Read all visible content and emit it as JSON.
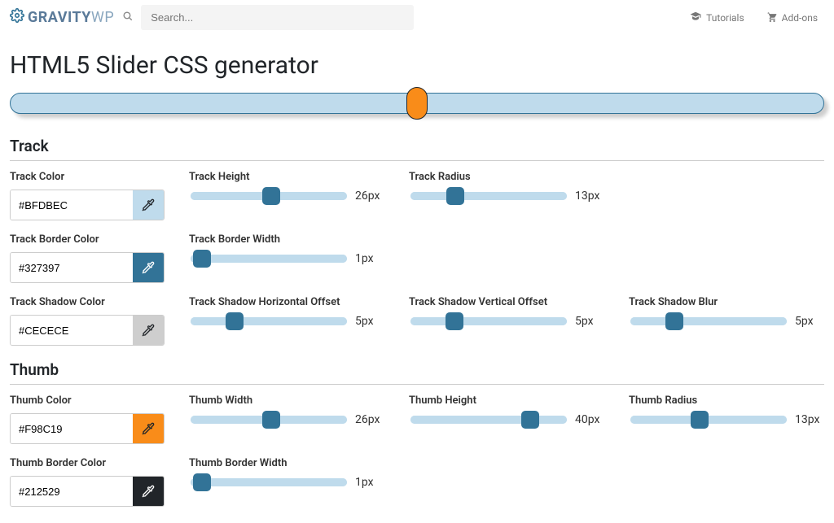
{
  "brand": {
    "strong": "GRAVITY",
    "light": "WP"
  },
  "search": {
    "placeholder": "Search..."
  },
  "nav": {
    "tutorials": "Tutorials",
    "addons": "Add-ons"
  },
  "page": {
    "title": "HTML5 Slider CSS generator"
  },
  "sections": {
    "track": "Track",
    "thumb": "Thumb"
  },
  "labels": {
    "trackColor": "Track Color",
    "trackBorderColor": "Track Border Color",
    "trackShadowColor": "Track Shadow Color",
    "trackHeight": "Track Height",
    "trackRadius": "Track Radius",
    "trackBorderWidth": "Track Border Width",
    "trackShadowHOff": "Track Shadow Horizontal Offset",
    "trackShadowVOff": "Track Shadow Vertical Offset",
    "trackShadowBlur": "Track Shadow Blur",
    "thumbColor": "Thumb Color",
    "thumbBorderColor": "Thumb Border Color",
    "thumbWidth": "Thumb Width",
    "thumbHeight": "Thumb Height",
    "thumbRadius": "Thumb Radius",
    "thumbBorderWidth": "Thumb Border Width"
  },
  "values": {
    "trackColor": "#BFDBEC",
    "trackBorderColor": "#327397",
    "trackShadowColor": "#CECECE",
    "trackHeight": "26px",
    "trackRadius": "13px",
    "trackBorderWidth": "1px",
    "trackShadowHOff": "5px",
    "trackShadowVOff": "5px",
    "trackShadowBlur": "5px",
    "thumbColor": "#F98C19",
    "thumbBorderColor": "#212529",
    "thumbWidth": "26px",
    "thumbHeight": "40px",
    "thumbRadius": "13px",
    "thumbBorderWidth": "1px"
  },
  "ranges": {
    "trackHeight": {
      "min": 0,
      "max": 50,
      "value": 26
    },
    "trackRadius": {
      "min": 0,
      "max": 50,
      "value": 13
    },
    "trackBorderWidth": {
      "min": 0,
      "max": 50,
      "value": 1
    },
    "trackShadowHOff": {
      "min": 0,
      "max": 20,
      "value": 5
    },
    "trackShadowVOff": {
      "min": 0,
      "max": 20,
      "value": 5
    },
    "trackShadowBlur": {
      "min": 0,
      "max": 20,
      "value": 5
    },
    "thumbWidth": {
      "min": 0,
      "max": 50,
      "value": 26
    },
    "thumbHeight": {
      "min": 0,
      "max": 50,
      "value": 40
    },
    "thumbRadius": {
      "min": 0,
      "max": 30,
      "value": 13
    },
    "thumbBorderWidth": {
      "min": 0,
      "max": 50,
      "value": 1
    }
  }
}
